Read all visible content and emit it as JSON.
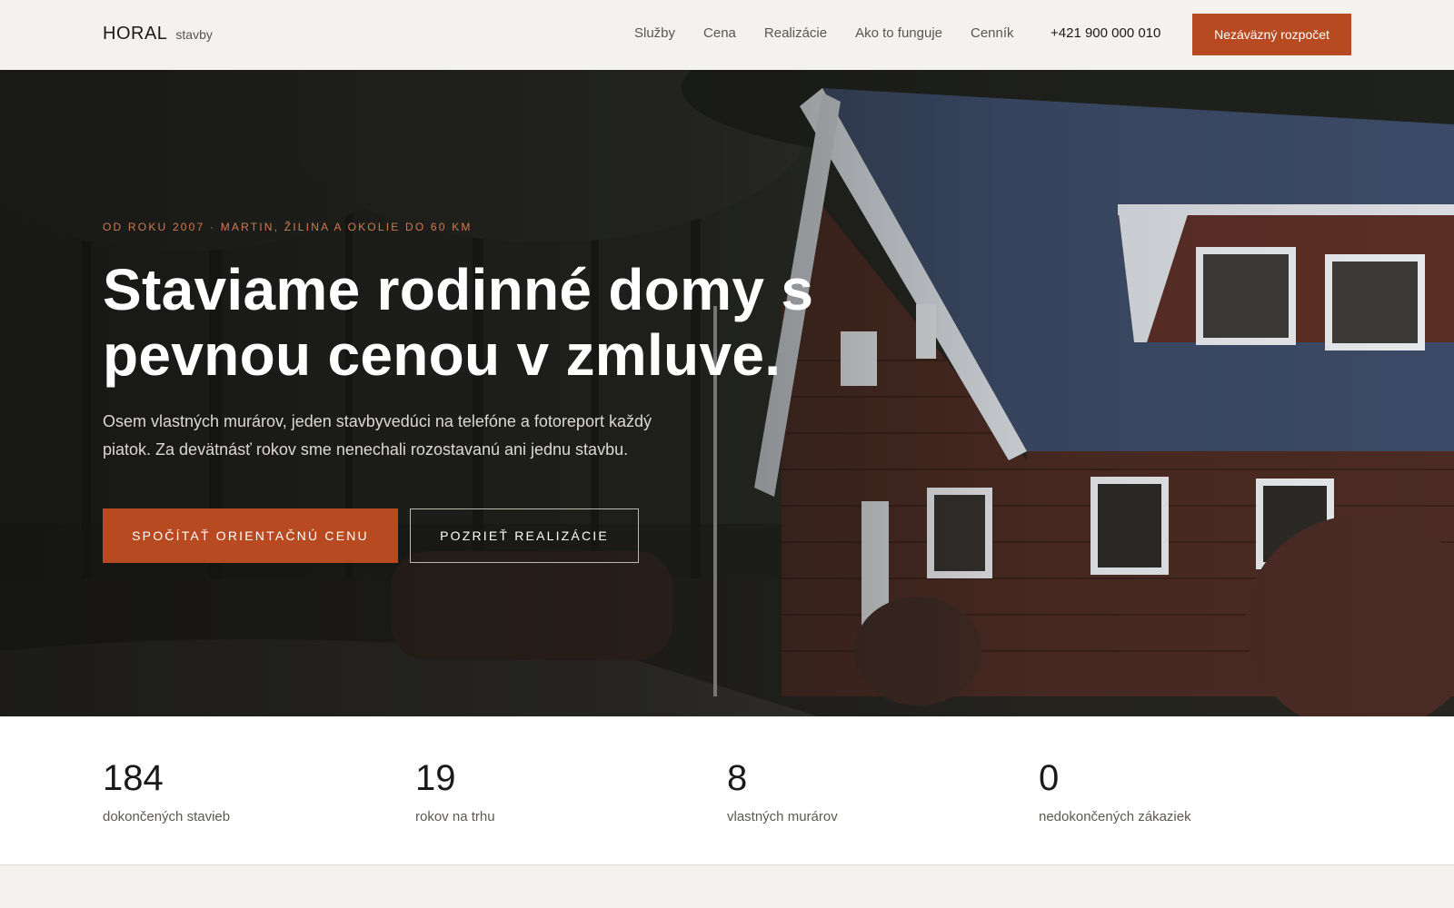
{
  "header": {
    "logo_main": "HORAL",
    "logo_sub": "stavby",
    "nav": [
      "Služby",
      "Cena",
      "Realizácie",
      "Ako to funguje",
      "Cenník"
    ],
    "phone": "+421 900 000 010",
    "cta": "Nezáväzný rozpočet"
  },
  "hero": {
    "eyebrow": "OD ROKU 2007 · MARTIN, ŽILINA A OKOLIE DO 60 KM",
    "title": "Staviame rodinné domy s pevnou cenou v zmluve.",
    "text": "Osem vlastných murárov, jeden stavbyvedúci na telefóne a fotoreport každý piatok. Za devätnásť rokov sme nenechali rozostavanú ani jednu stavbu.",
    "primary_button": "SPOČÍTAŤ ORIENTAČNÚ CENU",
    "secondary_button": "POZRIEŤ REALIZÁCIE"
  },
  "stats": [
    {
      "value": "184",
      "label": "dokončených stavieb"
    },
    {
      "value": "19",
      "label": "rokov na trhu"
    },
    {
      "value": "8",
      "label": "vlastných murárov"
    },
    {
      "value": "0",
      "label": "nedokončených zákaziek"
    }
  ],
  "colors": {
    "accent": "#b84a22",
    "header_bg": "#f4f2ef",
    "eyebrow": "#d07a4e"
  }
}
